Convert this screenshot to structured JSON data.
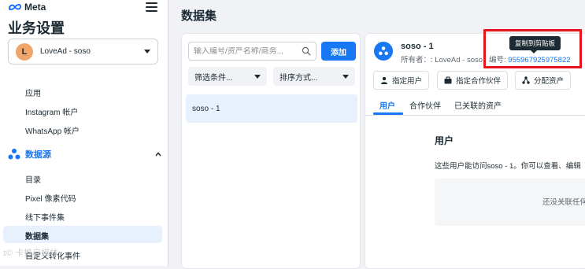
{
  "sidebar": {
    "brand": "Meta",
    "section_title": "业务设置",
    "account": {
      "avatar_letter": "L",
      "name": "LoveAd - soso",
      "avatar_color": "#f0a56a"
    },
    "items": [
      {
        "label": "应用"
      },
      {
        "label": "Instagram 帐户"
      },
      {
        "label": "WhatsApp 帐户"
      }
    ],
    "group": {
      "label": "数据源",
      "icon": "data-sources-icon"
    },
    "group_items": [
      {
        "label": "目录"
      },
      {
        "label": "Pixel 像素代码"
      },
      {
        "label": "线下事件集"
      },
      {
        "label": "数据集"
      },
      {
        "label": "自定义转化事件"
      }
    ],
    "watermark": "ɪ© 卡推自媒体"
  },
  "main": {
    "title": "数据集",
    "list": {
      "search_placeholder": "输入编号/资产名称/商务...",
      "add_label": "添加",
      "filter_label": "筛选条件...",
      "sort_label": "排序方式...",
      "items": [
        {
          "label": "soso - 1"
        }
      ]
    },
    "detail": {
      "name": "soso - 1",
      "owner": "所有者：: LoveAd - soso",
      "id_label": "编号: ",
      "id_value": "955967925975822",
      "tooltip": "复制到剪贴板",
      "actions": [
        {
          "label": "指定用户",
          "icon": "person-icon"
        },
        {
          "label": "指定合作伙伴",
          "icon": "briefcase-icon"
        },
        {
          "label": "分配资产",
          "icon": "share-icon"
        }
      ],
      "tabs": [
        {
          "label": "用户",
          "active": true
        },
        {
          "label": "合作伙伴",
          "active": false
        },
        {
          "label": "已关联的资产",
          "active": false
        }
      ],
      "section_title": "用户",
      "section_desc": "这些用户能访问soso - 1。你可以查看、编辑",
      "empty_text": "还没关联任何"
    }
  },
  "colors": {
    "accent": "#1877f2",
    "highlight": "#e8141c"
  }
}
